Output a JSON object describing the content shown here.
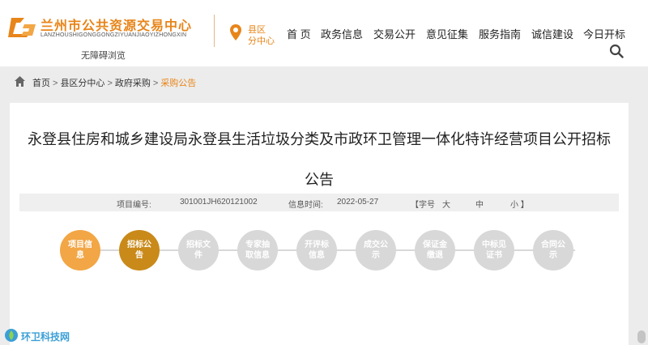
{
  "header": {
    "logo_cn": "兰州市公共资源交易中心",
    "logo_en": "LANZHOUSHIGONGGONGZIYUANJIAOYIZHONGXIN",
    "accessibility": "无障碍浏览",
    "location_line1": "县区",
    "location_line2": "分中心",
    "nav": [
      "首 页",
      "政务信息",
      "交易公开",
      "意见征集",
      "服务指南",
      "诚信建设",
      "今日开标"
    ]
  },
  "breadcrumb": [
    "首页",
    "县区分中心",
    "政府采购",
    "采购公告"
  ],
  "article": {
    "title_line1": "永登县住房和城乡建设局永登县生活垃圾分类及市政环卫管理一体化特许经营项目公开招标",
    "title_line2": "公告",
    "project_no_label": "项目编号:",
    "project_no": "301001JH620121002",
    "info_time_label": "信息时间:",
    "info_time": "2022-05-27",
    "font_size_label": "【字号",
    "font_large": "大",
    "font_medium": "中",
    "font_small": "小 】"
  },
  "steps": [
    {
      "label": "项目信息",
      "state": "done"
    },
    {
      "label": "招标公告",
      "state": "active"
    },
    {
      "label": "招标文件",
      "state": "pending"
    },
    {
      "label": "专家抽取信息",
      "state": "pending"
    },
    {
      "label": "开评标信息",
      "state": "pending"
    },
    {
      "label": "成交公示",
      "state": "pending"
    },
    {
      "label": "保证金缴退",
      "state": "pending"
    },
    {
      "label": "中标见证书",
      "state": "pending"
    },
    {
      "label": "合同公示",
      "state": "pending"
    }
  ],
  "watermark": "环卫科技网",
  "colors": {
    "accent": "#e8851a",
    "step_done": "#f2a645",
    "step_active": "#c98a1a",
    "step_pending": "#d8d8d8"
  },
  "icons": [
    "logo-icon",
    "location-pin-icon",
    "search-icon",
    "home-icon",
    "watermark-icon"
  ]
}
